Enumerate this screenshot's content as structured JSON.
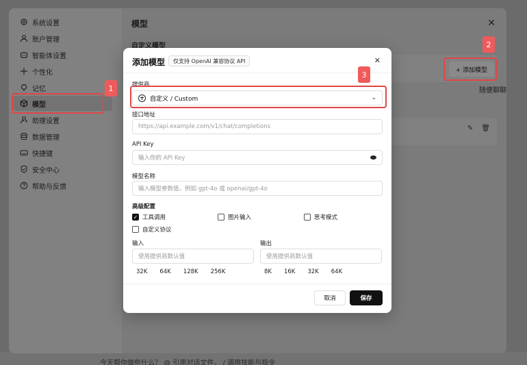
{
  "sidebar": {
    "items": [
      {
        "label": "系统设置",
        "icon": "gear-icon"
      },
      {
        "label": "账户管理",
        "icon": "user-icon"
      },
      {
        "label": "智能体设置",
        "icon": "agent-icon"
      },
      {
        "label": "个性化",
        "icon": "sparkle-icon"
      },
      {
        "label": "记忆",
        "icon": "pin-icon"
      },
      {
        "label": "模型",
        "icon": "cube-icon"
      },
      {
        "label": "助理设置",
        "icon": "assistant-icon"
      },
      {
        "label": "数据管理",
        "icon": "database-icon"
      },
      {
        "label": "快捷键",
        "icon": "keyboard-icon"
      },
      {
        "label": "安全中心",
        "icon": "shield-icon"
      },
      {
        "label": "帮助与反馈",
        "icon": "help-icon"
      }
    ]
  },
  "main": {
    "title": "模型",
    "close": "✕",
    "section_label": "自定义模型",
    "add_model_label": "+ 添加模型",
    "overflow_text": "随便聊聊",
    "edit_icon": "✎",
    "delete_icon": "🗑"
  },
  "dialog": {
    "title": "添加模型",
    "badge": "仅支持 OpenAI 兼容协议 API",
    "close": "✕",
    "provider_label": "提供商",
    "provider_value": "自定义 / Custom",
    "chevron": "⌄",
    "endpoint_label": "接口地址",
    "endpoint_placeholder": "https://api.example.com/v1/chat/completions",
    "apikey_label": "API Key",
    "apikey_placeholder": "输入你的 API Key",
    "model_name_label": "模型名称",
    "model_name_placeholder": "输入模型参数值，例如 gpt-4o 或 openai/gpt-4o",
    "advanced_label": "高级配置",
    "checks": [
      {
        "label": "工具调用",
        "checked": true
      },
      {
        "label": "图片输入",
        "checked": false
      },
      {
        "label": "思考模式",
        "checked": false
      },
      {
        "label": "自定义协议",
        "checked": false
      }
    ],
    "input_label": "输入",
    "output_label": "输出",
    "input_placeholder": "使用提供商默认值",
    "output_placeholder": "使用提供商默认值",
    "input_chips": [
      "32K",
      "64K",
      "128K",
      "256K"
    ],
    "output_chips": [
      "8K",
      "16K",
      "32K",
      "64K"
    ],
    "cancel_label": "取消",
    "save_label": "保存",
    "check_mark": "✓"
  },
  "bottom_hint": "今天帮你做些什么？  @ 引用对话文件，  / 调用技能与指令",
  "annotations": [
    "1",
    "2",
    "3"
  ],
  "colors": {
    "annotation": "#e04646",
    "save_button": "#111111"
  }
}
